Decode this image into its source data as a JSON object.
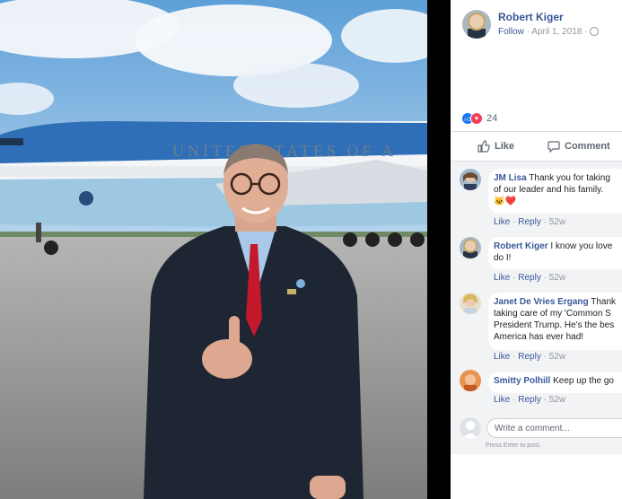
{
  "post": {
    "author": "Robert Kiger",
    "follow_label": "Follow",
    "dot": "·",
    "date": "April 1, 2018",
    "audience_icon": "globe-icon"
  },
  "photo": {
    "plane_text": "UNITED STATES OF A"
  },
  "reactions": {
    "types": [
      "like",
      "love"
    ],
    "count": "24"
  },
  "actions": {
    "like_label": "Like",
    "comment_label": "Comment"
  },
  "comments": [
    {
      "author": "JM Lisa",
      "line1": "Thank you for taking",
      "line2": "of our leader and his family.",
      "line3": "🐱❤️",
      "like": "Like",
      "reply": "Reply",
      "time": "52w"
    },
    {
      "author": "Robert Kiger",
      "line1": "I know you love",
      "line2": "do I!",
      "line3": "",
      "like": "Like",
      "reply": "Reply",
      "time": "52w"
    },
    {
      "author": "Janet De Vries Ergang",
      "line1": "Thank",
      "line2": "taking care of my 'Common S",
      "line3": "President Trump. He's the bes",
      "line4": "America has ever had!",
      "like": "Like",
      "reply": "Reply",
      "time": "52w"
    },
    {
      "author": "Smitty Polhill",
      "line1": "Keep up the go",
      "line2": "",
      "line3": "",
      "like": "Like",
      "reply": "Reply",
      "time": "52w"
    }
  ],
  "composer": {
    "placeholder": "Write a comment...",
    "hint": "Press Enter to post."
  },
  "colors": {
    "link": "#385898",
    "like_blue": "#1877f2",
    "love_red": "#f33e58",
    "plane_blue": "#2f6fb8"
  }
}
